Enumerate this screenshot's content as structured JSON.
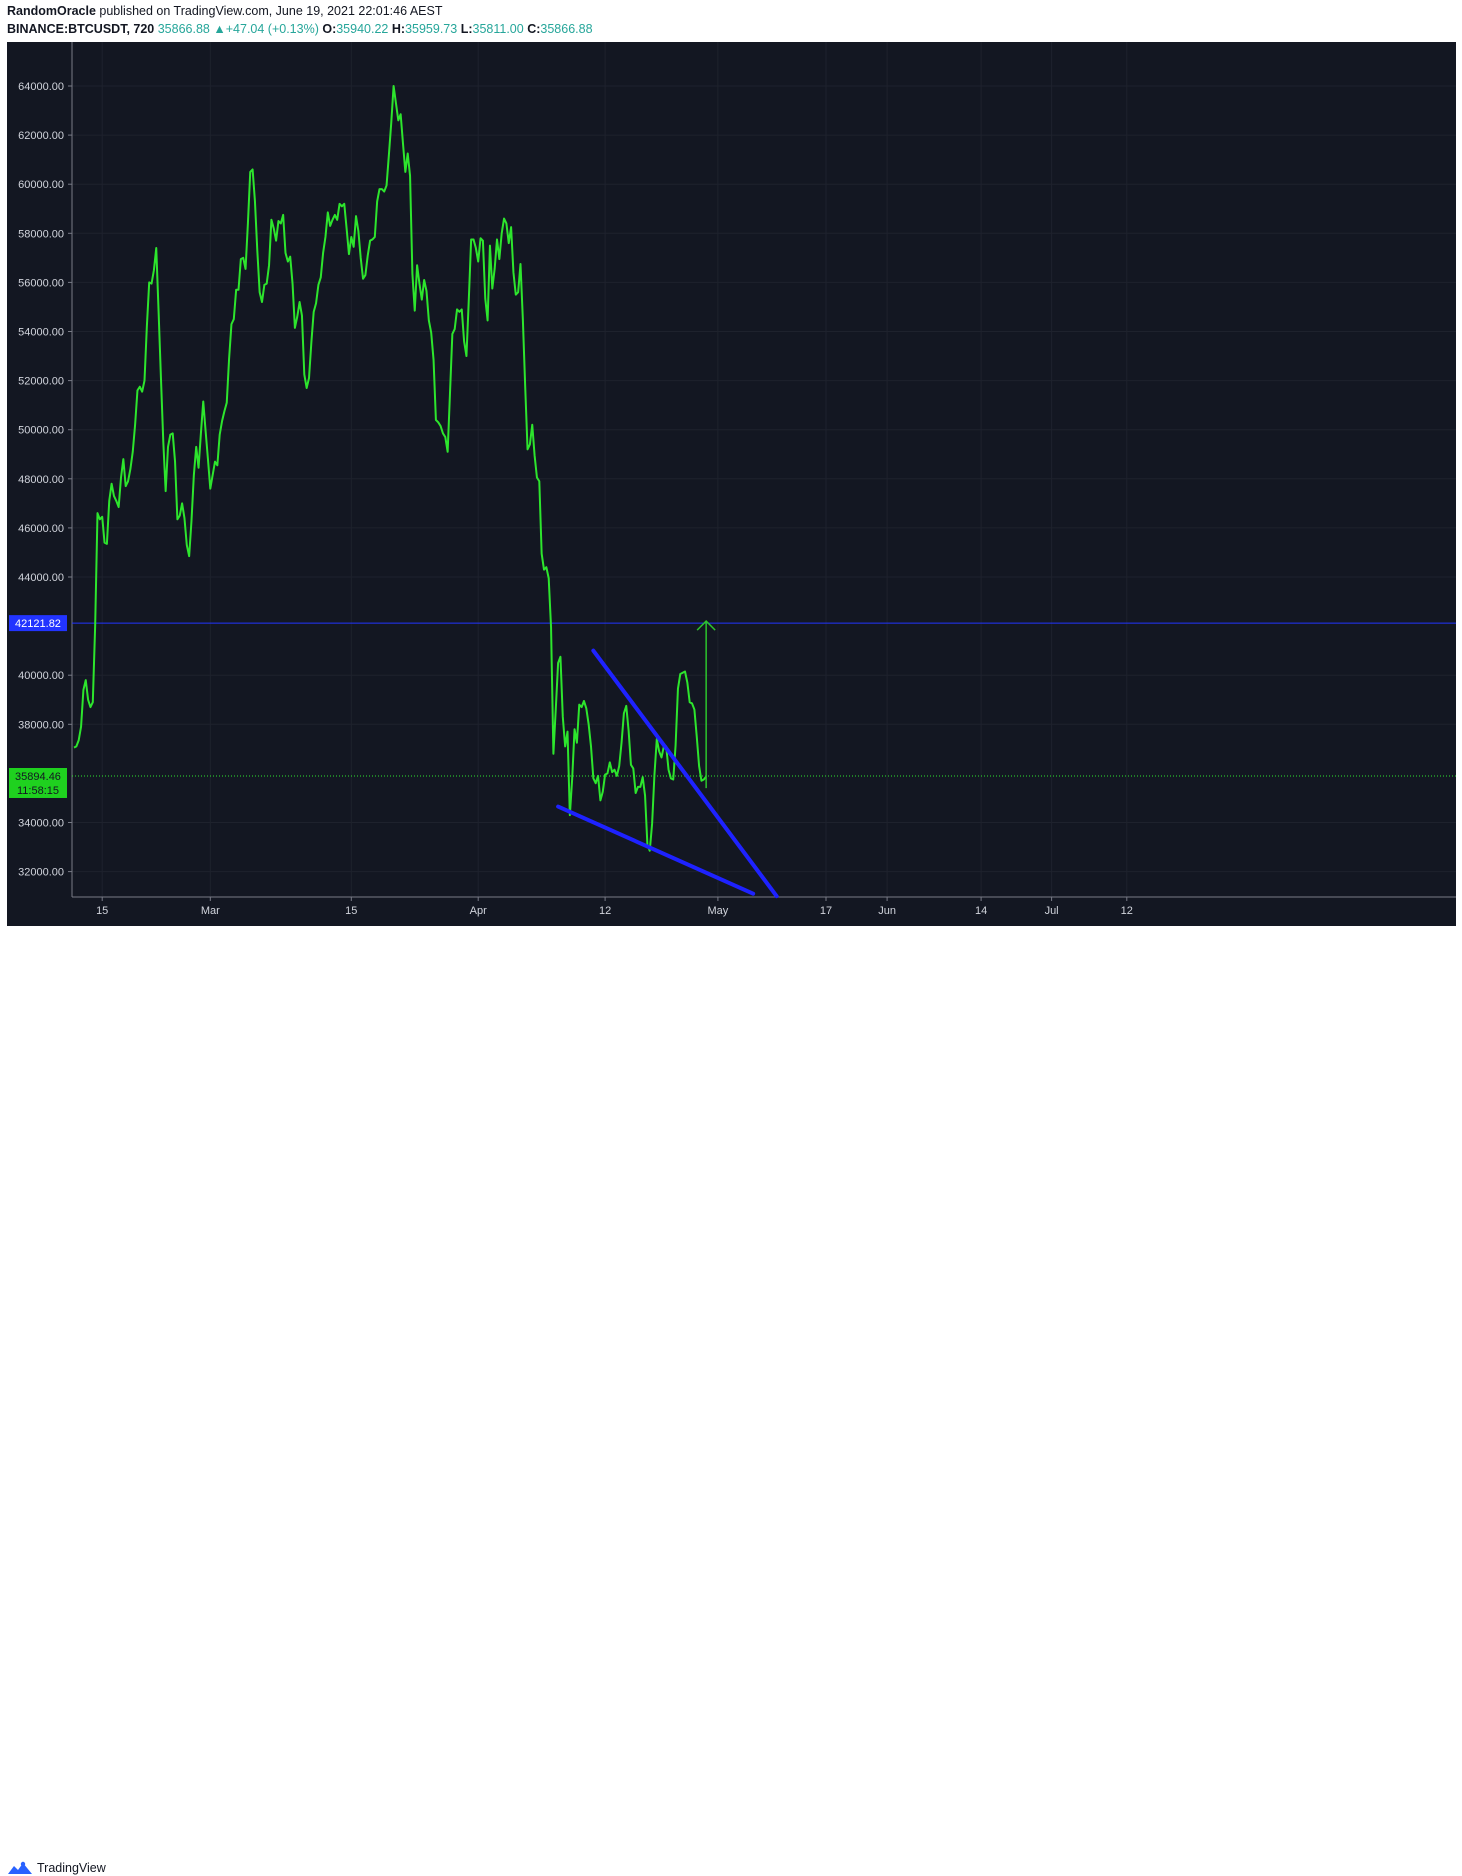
{
  "header": {
    "author": "RandomOracle",
    "published_text": "published on TradingView.com, June 19, 2021 22:01:46 AEST",
    "symbol": "BINANCE:BTCUSDT, 720",
    "last": "35866.88",
    "change": "+47.04 (+0.13%)",
    "o_label": "O:",
    "o_value": "35940.22",
    "h_label": "H:",
    "h_value": "35959.73",
    "l_label": "L:",
    "l_value": "35811.00",
    "c_label": "C:",
    "c_value": "35866.88"
  },
  "footer": {
    "brand": "TradingView"
  },
  "colors": {
    "background": "#131722",
    "price_line": "#2de52d",
    "trend_line": "#1e22ff",
    "level_line": "#2234ff",
    "grid": "#1e222d",
    "axis_text": "#d1d4dc"
  },
  "chart_data": {
    "type": "line",
    "series": [
      {
        "values": [
          37050,
          37100,
          37350,
          37900,
          39400,
          39800,
          39000,
          38700,
          38900,
          42000,
          46600,
          46350,
          46450,
          45400,
          45350,
          47100,
          47800,
          47300,
          47100,
          46850,
          48050,
          48800,
          47700,
          47900,
          48400,
          49100,
          50200,
          51600,
          51750,
          51550,
          52000,
          54200,
          56000,
          55950,
          56500,
          57400,
          54800,
          52100,
          49500,
          47500,
          49300,
          49800,
          49850,
          48700,
          46350,
          46500,
          47000,
          46400,
          45300,
          44850,
          46300,
          48150,
          49300,
          48450,
          49850,
          51150,
          49950,
          48800,
          47600,
          48150,
          48700,
          48550,
          49800,
          50350,
          50750,
          51100,
          52900,
          54300,
          54500,
          55700,
          55700,
          56950,
          57000,
          56550,
          58400,
          60500,
          60600,
          59300,
          57300,
          55600,
          55200,
          55900,
          55950,
          56700,
          58550,
          58200,
          57700,
          58500,
          58400,
          58750,
          57200,
          56850,
          57050,
          55950,
          54150,
          54600,
          55200,
          54650,
          52250,
          51700,
          52100,
          53550,
          54800,
          55150,
          55900,
          56200,
          57200,
          57850,
          58850,
          58300,
          58550,
          58750,
          58550,
          59200,
          59100,
          59200,
          58200,
          57150,
          57850,
          57450,
          58700,
          58100,
          57000,
          56150,
          56300,
          57100,
          57700,
          57750,
          57850,
          59300,
          59800,
          59800,
          59700,
          59950,
          61200,
          62500,
          64000,
          63300,
          62600,
          62850,
          61650,
          60500,
          61250,
          60350,
          56350,
          54850,
          56700,
          55950,
          55300,
          56100,
          55650,
          54450,
          53950,
          52850,
          50400,
          50300,
          50150,
          49850,
          49700,
          49100,
          51500,
          53900,
          54100,
          54900,
          54800,
          54900,
          53600,
          53000,
          55300,
          57750,
          57750,
          57400,
          56850,
          57800,
          57700,
          55350,
          54450,
          57500,
          55750,
          56550,
          57750,
          56950,
          58000,
          58600,
          58400,
          57600,
          58250,
          56400,
          55500,
          55600,
          56750,
          54500,
          51750,
          49200,
          49400,
          50200,
          48950,
          48050,
          47900,
          44950,
          44300,
          44400,
          43950,
          41950,
          36800,
          38600,
          40500,
          40750,
          38300,
          37100,
          37700,
          34300,
          35800,
          37800,
          37250,
          38800,
          38700,
          38950,
          38650,
          38000,
          37100,
          35800,
          35600,
          35900,
          34900,
          35250,
          35950,
          36000,
          36450,
          36050,
          36150,
          35900,
          36300,
          37250,
          38450,
          38750,
          37750,
          36350,
          36200,
          35200,
          35450,
          35450,
          35850,
          35100,
          33100,
          32850,
          33950,
          35950,
          37400,
          36900,
          36650,
          37100,
          37100,
          36150,
          35800,
          35750,
          37150,
          39450,
          40050,
          40100,
          40150,
          39700,
          38900,
          38850,
          38600,
          37500,
          36300,
          35700,
          35750,
          35866.88
        ]
      }
    ],
    "x_tick_labels": [
      "15",
      "Mar",
      "15",
      "Apr",
      "12",
      "May",
      "17",
      "Jun",
      "14",
      "Jul",
      "12"
    ],
    "y_tick_labels": [
      "64000.00",
      "62000.00",
      "60000.00",
      "58000.00",
      "56000.00",
      "54000.00",
      "52000.00",
      "50000.00",
      "48000.00",
      "46000.00",
      "44000.00",
      "40000.00",
      "38000.00",
      "34000.00",
      "32000.00"
    ],
    "level_value": 42121.82,
    "level_label": "42121.82",
    "last_price_label": "35894.46",
    "countdown_label": "11:58:15",
    "trendlines": [
      {
        "from": [
          221,
          41000
        ],
        "to": [
          299,
          31000
        ]
      },
      {
        "from": [
          206,
          34650
        ],
        "to": [
          289,
          31100
        ]
      }
    ],
    "arrow": {
      "x": 269,
      "from": 35400,
      "to": 42121.82
    }
  }
}
